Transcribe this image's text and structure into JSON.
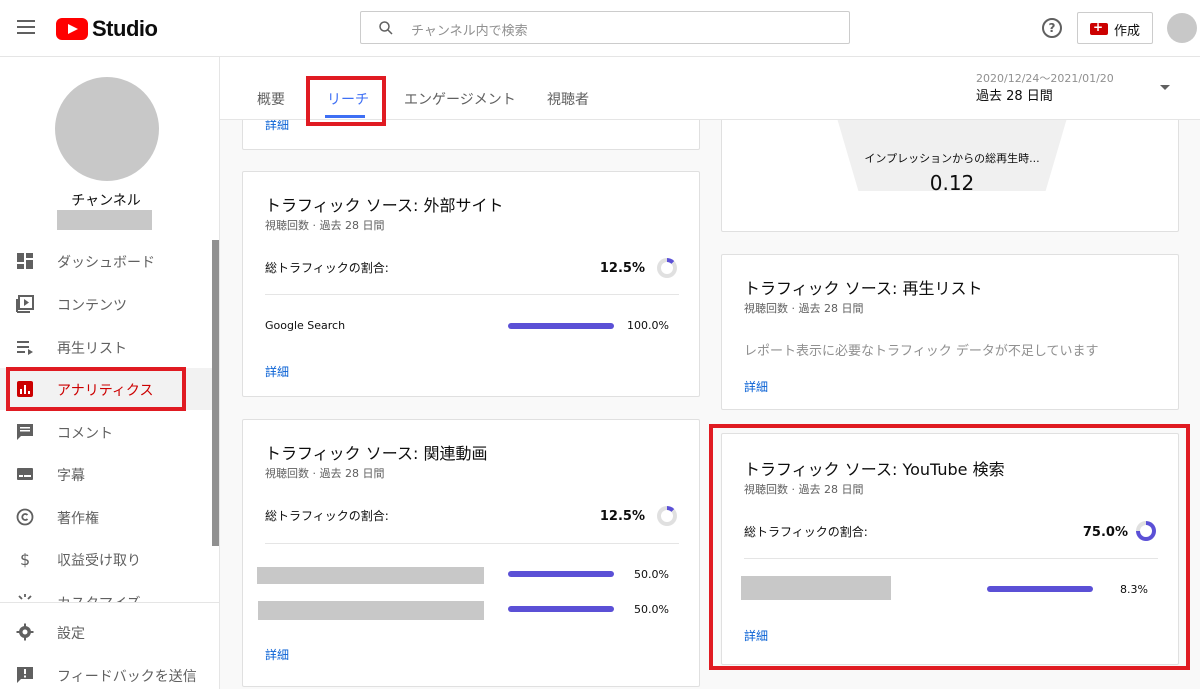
{
  "app": {
    "title": "Studio"
  },
  "search": {
    "placeholder": "チャンネル内で検索"
  },
  "header": {
    "create_label": "作成",
    "help_glyph": "?"
  },
  "channel": {
    "name": "チャンネル"
  },
  "sidebar": {
    "items": [
      {
        "label": "ダッシュボード",
        "icon": "dashboard-icon"
      },
      {
        "label": "コンテンツ",
        "icon": "content-icon"
      },
      {
        "label": "再生リスト",
        "icon": "playlist-icon"
      },
      {
        "label": "アナリティクス",
        "icon": "analytics-icon",
        "active": true
      },
      {
        "label": "コメント",
        "icon": "comment-icon"
      },
      {
        "label": "字幕",
        "icon": "subtitles-icon"
      },
      {
        "label": "著作権",
        "icon": "copyright-icon"
      },
      {
        "label": "収益受け取り",
        "icon": "dollar-icon"
      },
      {
        "label": "カスタマイズ",
        "icon": "customize-icon"
      }
    ],
    "bottom_items": [
      {
        "label": "設定",
        "icon": "gear-icon"
      },
      {
        "label": "フィードバックを送信",
        "icon": "feedback-icon"
      }
    ]
  },
  "tabs": [
    {
      "label": "概要"
    },
    {
      "label": "リーチ",
      "active": true
    },
    {
      "label": "エンゲージメント"
    },
    {
      "label": "視聴者"
    }
  ],
  "date": {
    "range": "2020/12/24〜2021/01/20",
    "label": "過去 28 日間"
  },
  "top_left_card": {
    "detail_label": "詳細"
  },
  "funnel": {
    "label": "インプレッションからの総再生時...",
    "value": "0.12"
  },
  "cards": {
    "external": {
      "title": "トラフィック ソース: 外部サイト",
      "subtitle": "視聴回数 · 過去 28 日間",
      "share_label": "総トラフィックの割合:",
      "share_value": "12.5%",
      "share_fraction": 0.125,
      "rows": [
        {
          "label": "Google Search",
          "pct": "100.0%",
          "fraction": 1.0
        }
      ],
      "detail_label": "詳細"
    },
    "related": {
      "title": "トラフィック ソース: 関連動画",
      "subtitle": "視聴回数 · 過去 28 日間",
      "share_label": "総トラフィックの割合:",
      "share_value": "12.5%",
      "share_fraction": 0.125,
      "rows": [
        {
          "pct": "50.0%",
          "fraction": 1.0
        },
        {
          "pct": "50.0%",
          "fraction": 1.0
        }
      ],
      "detail_label": "詳細"
    },
    "playlist": {
      "title": "トラフィック ソース: 再生リスト",
      "subtitle": "視聴回数 · 過去 28 日間",
      "message": "レポート表示に必要なトラフィック データが不足しています",
      "detail_label": "詳細"
    },
    "youtube_search": {
      "title": "トラフィック ソース: YouTube 検索",
      "subtitle": "視聴回数 · 過去 28 日間",
      "share_label": "総トラフィックの割合:",
      "share_value": "75.0%",
      "share_fraction": 0.75,
      "rows": [
        {
          "pct": "8.3%",
          "fraction": 1.0
        }
      ],
      "detail_label": "詳細"
    }
  },
  "colors": {
    "accent": "#3e6ff4",
    "bar": "#5b50d6",
    "highlight": "#e01b22",
    "brand_red": "#ff0000"
  }
}
